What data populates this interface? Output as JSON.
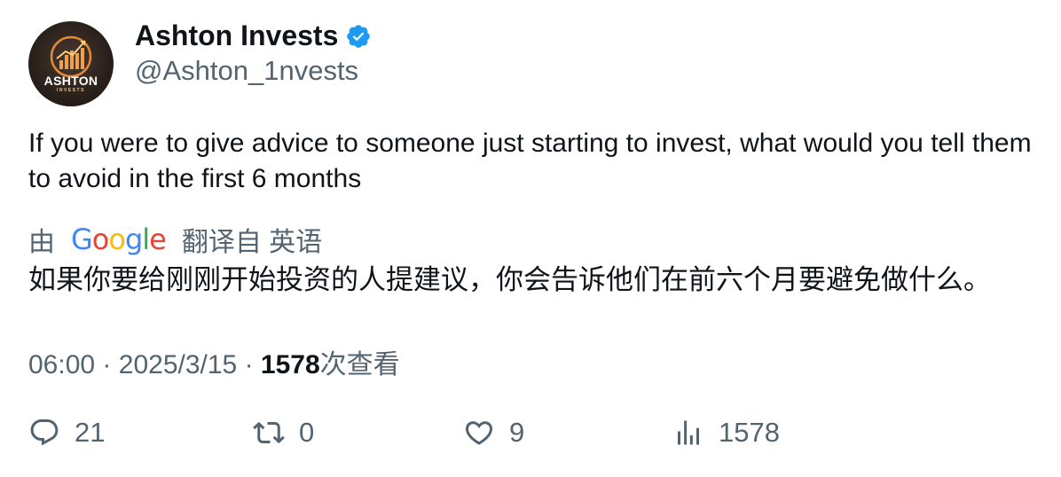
{
  "author": {
    "display_name": "Ashton Invests",
    "handle": "@Ashton_1nvests",
    "avatar_text": "ASHTON",
    "avatar_subtext": "INVESTS",
    "verified": true
  },
  "tweet": {
    "text": "If you were to give advice to someone just starting to invest, what would you tell them to avoid in the first 6 months",
    "translation": {
      "prefix": "由",
      "provider_letters": [
        "G",
        "o",
        "o",
        "g",
        "l",
        "e"
      ],
      "suffix": "翻译自 英语",
      "text": "如果你要给刚刚开始投资的人提建议，你会告诉他们在前六个月要避免做什么。"
    }
  },
  "meta": {
    "time": "06:00",
    "separator": "·",
    "date": "2025/3/15",
    "views_count": "1578",
    "views_label": "次查看"
  },
  "actions": {
    "replies": "21",
    "reposts": "0",
    "likes": "9",
    "views": "1578"
  },
  "colors": {
    "text_primary": "#0f1419",
    "text_secondary": "#536471",
    "verified_blue": "#1d9bf0"
  }
}
